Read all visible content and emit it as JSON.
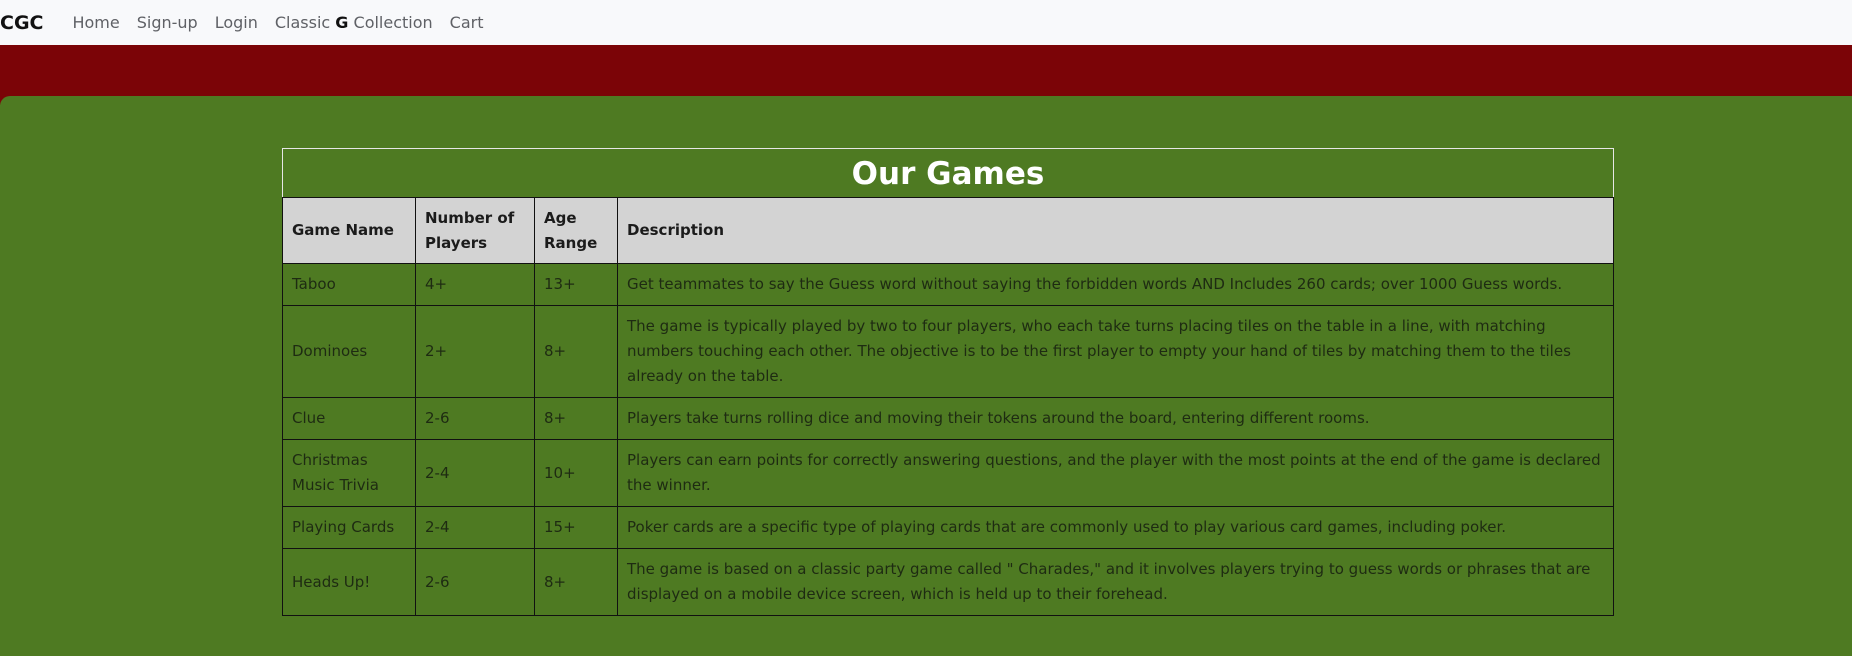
{
  "navbar": {
    "brand": "CGC",
    "links": {
      "home": "Home",
      "signup": "Sign-up",
      "login": "Login",
      "classic_prefix": "Classic ",
      "classic_g": "G",
      "classic_suffix": " Collection",
      "cart": "Cart"
    }
  },
  "table": {
    "title": "Our Games",
    "headers": {
      "name": "Game Name",
      "players": "Number of Players",
      "age": "Age Range",
      "description": "Description"
    },
    "rows": [
      {
        "name": "Taboo",
        "players": "4+",
        "age": "13+",
        "description": "Get teammates to say the Guess word without saying the forbidden words AND Includes 260 cards; over 1000 Guess words."
      },
      {
        "name": "Dominoes",
        "players": "2+",
        "age": "8+",
        "description": "The game is typically played by two to four players, who each take turns placing tiles on the table in a line, with matching numbers touching each other. The objective is to be the first player to empty your hand of tiles by matching them to the tiles already on the table."
      },
      {
        "name": "Clue",
        "players": "2-6",
        "age": "8+",
        "description": "Players take turns rolling dice and moving their tokens around the board, entering different rooms."
      },
      {
        "name": "Christmas Music Trivia",
        "players": "2-4",
        "age": "10+",
        "description": "Players can earn points for correctly answering questions, and the player with the most points at the end of the game is declared the winner."
      },
      {
        "name": "Playing Cards",
        "players": "2-4",
        "age": "15+",
        "description": "Poker cards are a specific type of playing cards that are commonly used to play various card games, including poker."
      },
      {
        "name": "Heads Up!",
        "players": "2-6",
        "age": "8+",
        "description": "The game is based on a classic party game called \" Charades,\" and it involves players trying to guess words or phrases that are displayed on a mobile device screen, which is held up to their forehead."
      }
    ]
  }
}
